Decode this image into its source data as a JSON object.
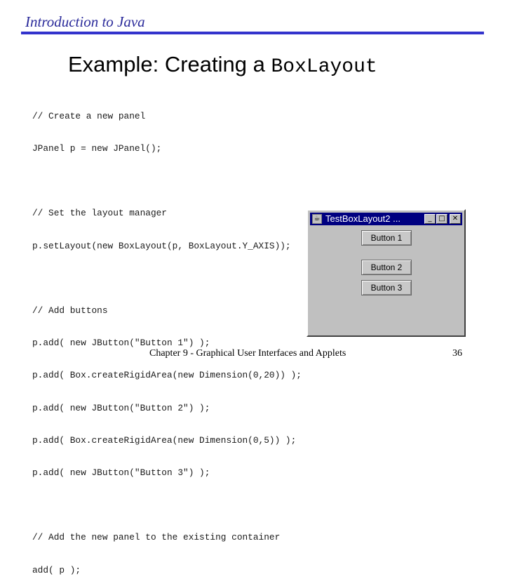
{
  "header": {
    "course_title": "Introduction to Java"
  },
  "slide": {
    "title_prefix": "Example: Creating a ",
    "title_code": "BoxLayout"
  },
  "code": {
    "lines": [
      "// Create a new panel",
      "JPanel p = new JPanel();",
      "",
      "// Set the layout manager",
      "p.setLayout(new BoxLayout(p, BoxLayout.Y_AXIS));",
      "",
      "// Add buttons",
      "p.add( new JButton(\"Button 1\") );",
      "p.add( Box.createRigidArea(new Dimension(0,20)) );",
      "p.add( new JButton(\"Button 2\") );",
      "p.add( Box.createRigidArea(new Dimension(0,5)) );",
      "p.add( new JButton(\"Button 3\") );",
      "",
      "// Add the new panel to the existing container",
      "add( p );"
    ]
  },
  "window": {
    "title": "TestBoxLayout2 ...",
    "controls": {
      "minimize": "_",
      "maximize": "□",
      "close": "✕"
    },
    "app_icon": "java-cup-icon",
    "buttons": [
      "Button 1",
      "Button 2",
      "Button 3"
    ]
  },
  "footer": {
    "text": "Chapter 9 - Graphical User Interfaces and Applets",
    "page_number": "36"
  },
  "colors": {
    "header_text": "#2a2a9a",
    "header_rule": "#3333cc",
    "titlebar": "#000080",
    "window_bg": "#c0c0c0"
  }
}
